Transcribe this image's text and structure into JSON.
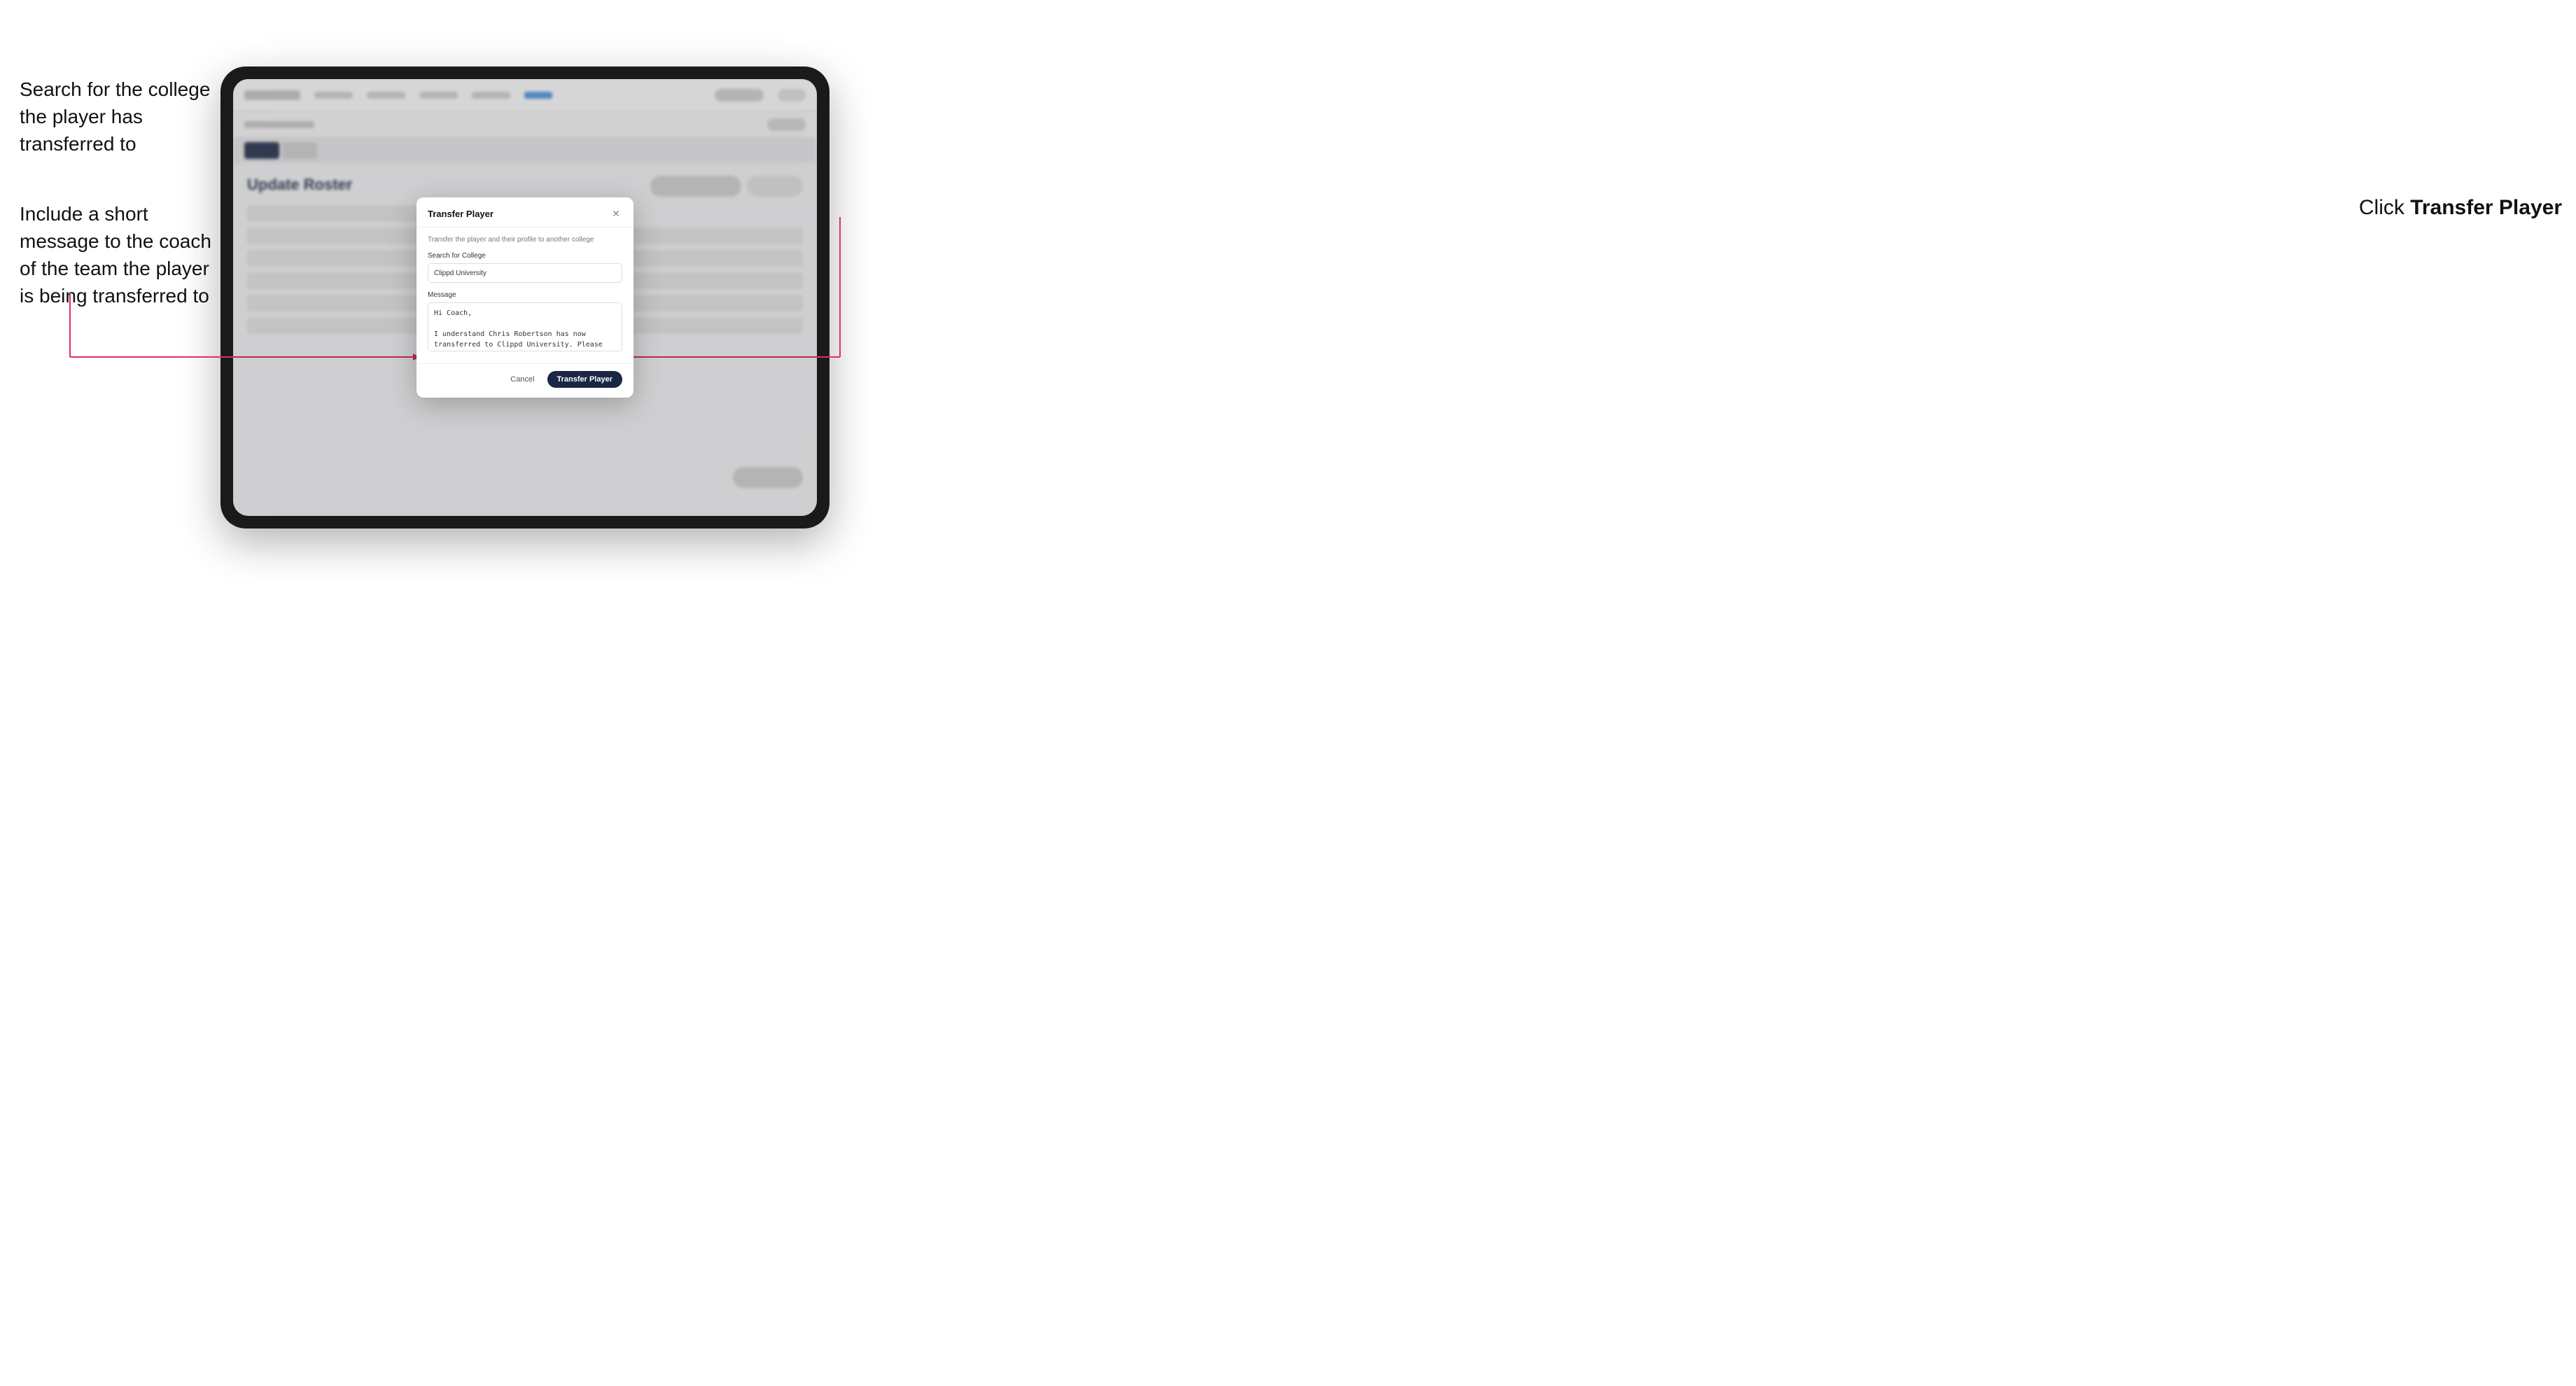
{
  "annotations": {
    "left_top": "Search for the college the player has transferred to",
    "left_bottom": "Include a short message to the coach of the team the player is being transferred to",
    "right": "Click ",
    "right_bold": "Transfer Player"
  },
  "modal": {
    "title": "Transfer Player",
    "description": "Transfer the player and their profile to another college",
    "search_label": "Search for College",
    "search_value": "Clippd University",
    "message_label": "Message",
    "message_value": "Hi Coach,\n\nI understand Chris Robertson has now transferred to Clippd University. Please accept this transfer request when you can.",
    "cancel_label": "Cancel",
    "transfer_label": "Transfer Player"
  },
  "app": {
    "page_title": "Update Roster"
  }
}
